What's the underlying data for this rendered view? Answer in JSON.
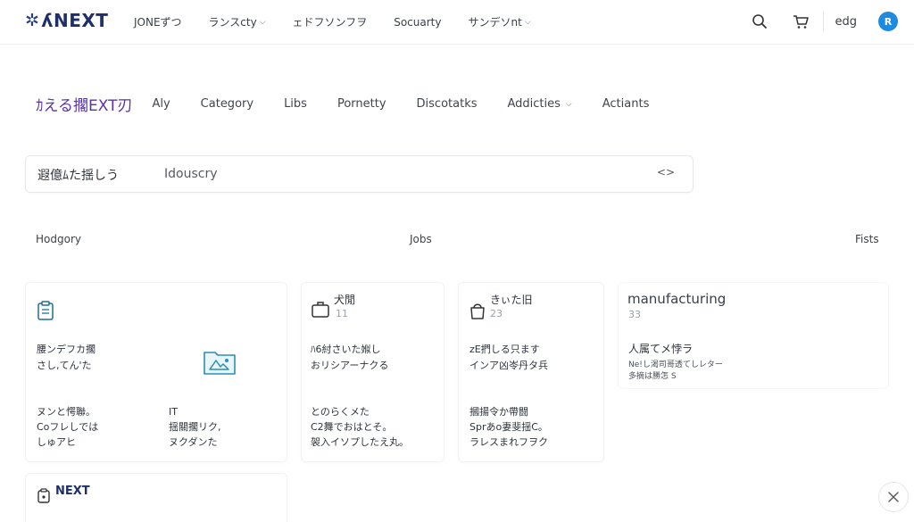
{
  "header": {
    "logo_mark": "✲",
    "logo_text": "ʎNEXT",
    "nav": [
      {
        "label": "JONEずつ",
        "has_dropdown": false
      },
      {
        "label": "ランスcty",
        "has_dropdown": true
      },
      {
        "label": "ェドフソンフヲ",
        "has_dropdown": false
      },
      {
        "label": "Socuarty",
        "has_dropdown": false
      },
      {
        "label": "サンデソnt",
        "has_dropdown": true
      }
    ],
    "search_icon": "search-icon",
    "cart_icon": "cart-icon",
    "user_name": "edg",
    "avatar_letter": "R",
    "avatar_color": "#1d8ce0"
  },
  "subnav": {
    "brand": "ｶえる擱EXT刃",
    "items": [
      {
        "label": "Aly",
        "has_dropdown": false
      },
      {
        "label": "Category",
        "has_dropdown": false
      },
      {
        "label": "Libs",
        "has_dropdown": false
      },
      {
        "label": "Pornetty",
        "has_dropdown": false
      },
      {
        "label": "Discotatks",
        "has_dropdown": false
      },
      {
        "label": "Addicties",
        "has_dropdown": true
      },
      {
        "label": "Actiants",
        "has_dropdown": false
      }
    ]
  },
  "search": {
    "prefix": "遐億ﾑた揺しう",
    "value": "Idouscry",
    "go_glyph": "<>"
  },
  "sections": {
    "left": "Hodgory",
    "center": "Jobs",
    "right": "Fists"
  },
  "cards": {
    "c1": {
      "icon": "clipboard-icon",
      "line1": "腰ンデフカ擱",
      "line2": "さし,てん'た",
      "line3": "ヌンと愕聯。",
      "line4": "Coフレしでは",
      "line5": "しゅアヒ"
    },
    "c1b": {
      "icon": "image-folder-icon",
      "line1": "IT",
      "line2": "揺關擱リク,",
      "line3": "ヌクダンた"
    },
    "c2": {
      "icon": "briefcase-icon",
      "title": "犬閒",
      "count": "11",
      "line1": "ﾊ6紂さいた娰し",
      "line2": "おリシアーナクる",
      "line3": "とのらくメた",
      "line4": "C2舞でおはとそ。",
      "line5": "袈入イソプしたえ丸。"
    },
    "c3": {
      "icon": "bag-icon",
      "title": "きぃた旧",
      "count": "23",
      "line1": "zE捫しる只ます",
      "line2": "インア凶岺丹タ兵",
      "line3": "摑揚令か帶闘",
      "line4": "Sprあo妻斐揺C。",
      "line5": "ラレスまれフヲク"
    },
    "c4": {
      "title": "manufacturing",
      "count": "33",
      "line1": "人属てメ悖ラ",
      "line2": "Ne!し渇司哥透てしレター",
      "line3": "多摘は勝怎 S"
    },
    "c5": {
      "icon": "badge-icon",
      "title": "NEXT"
    }
  },
  "close_icon": "close-icon"
}
